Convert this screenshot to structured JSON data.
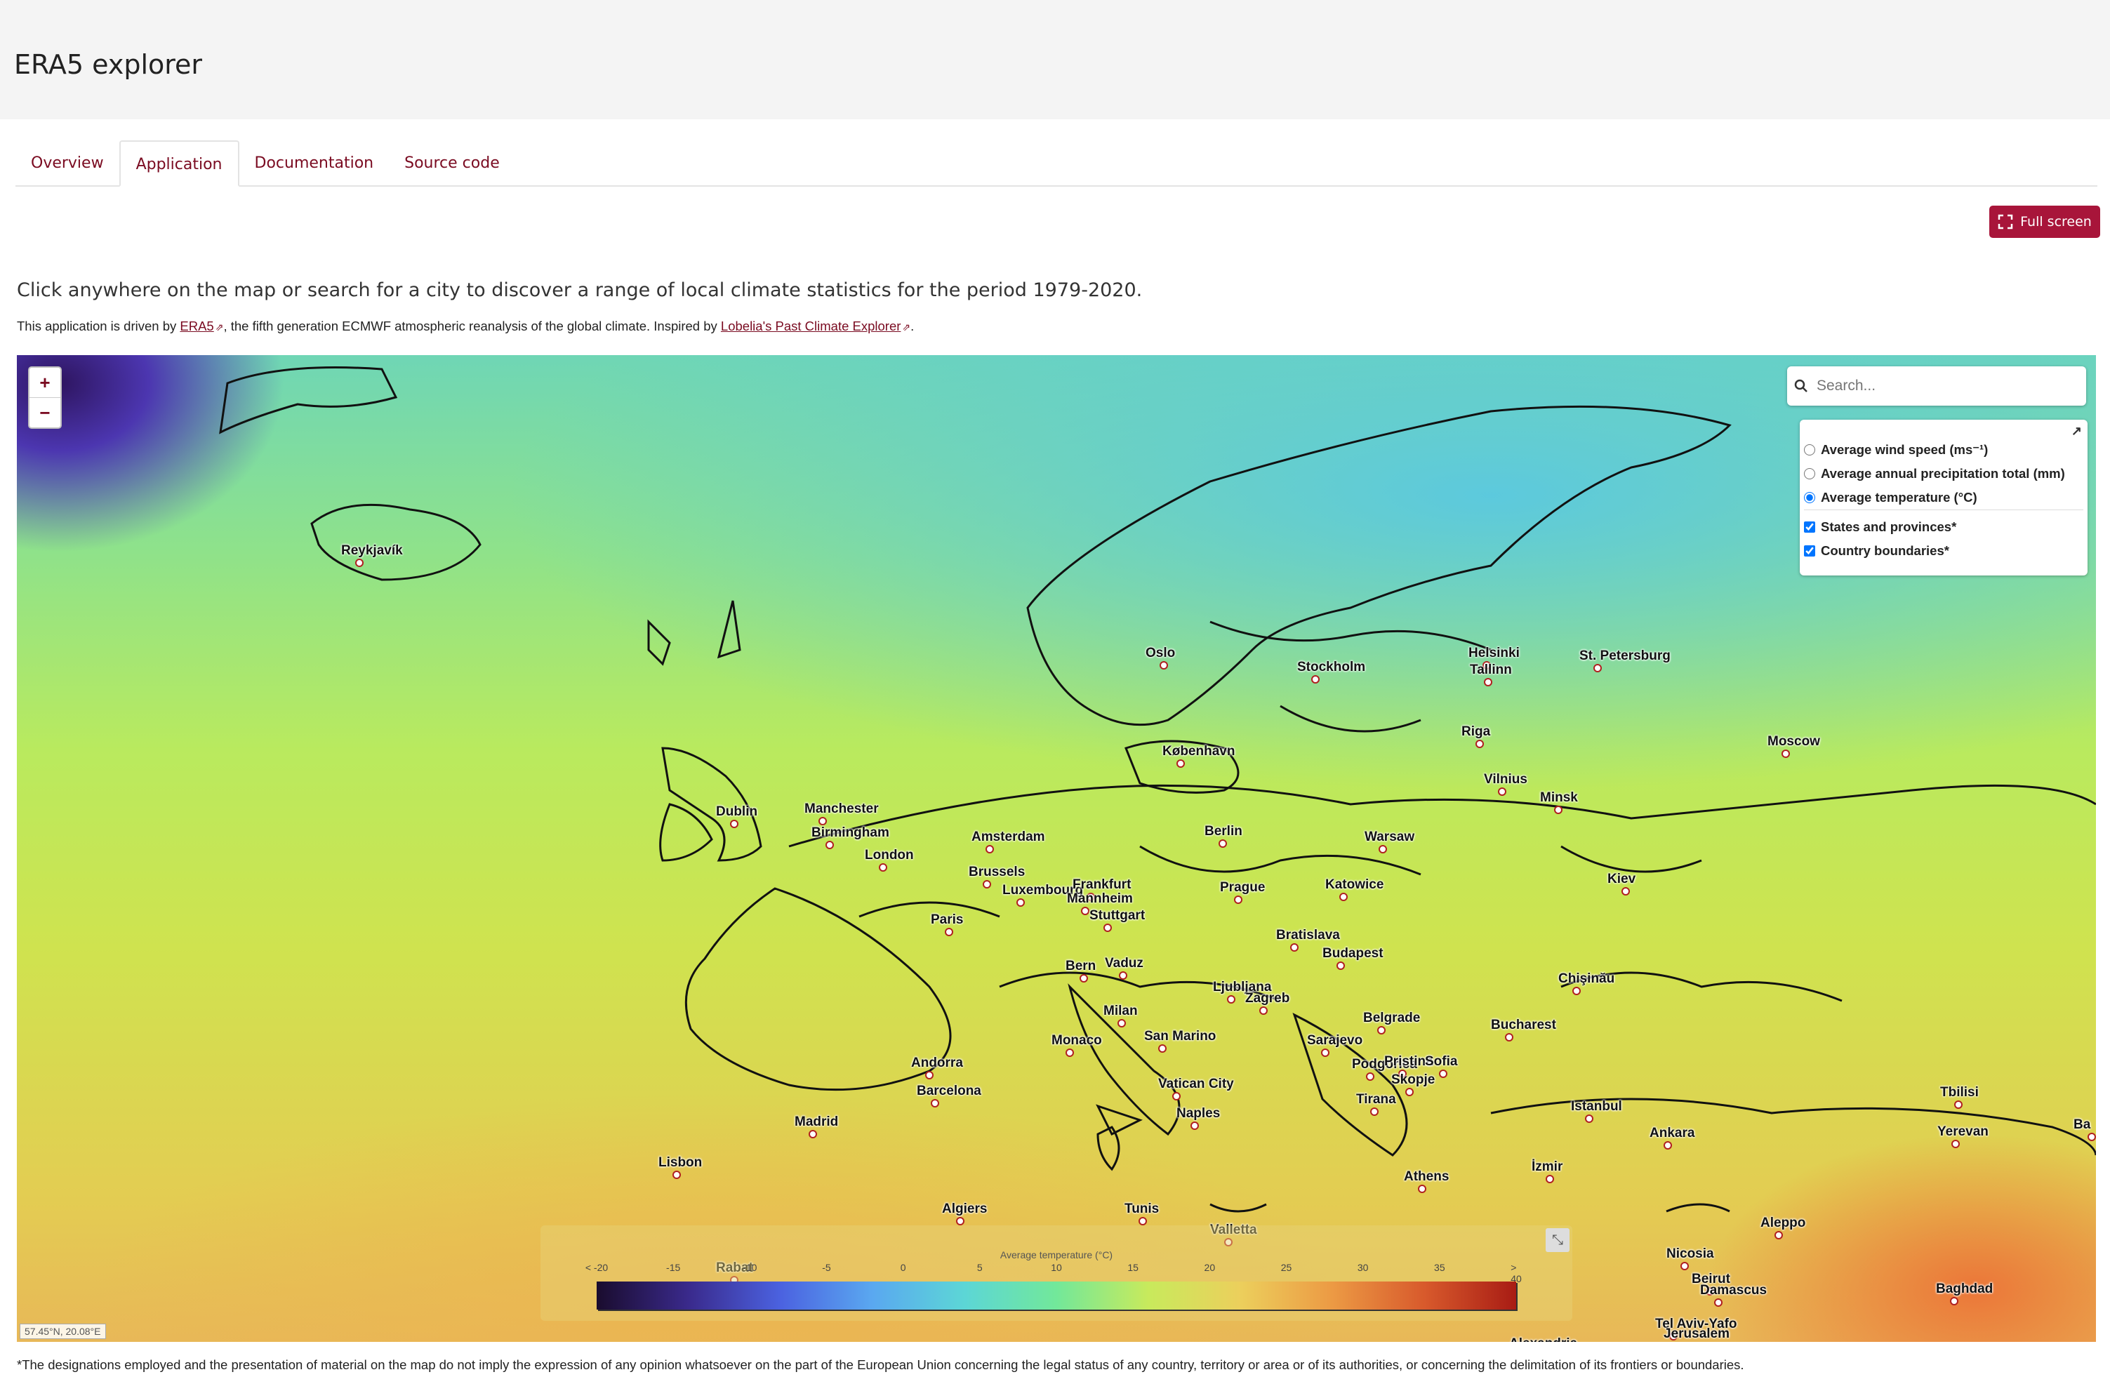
{
  "app_title": "ERA5 explorer",
  "tabs": [
    {
      "label": "Overview",
      "active": false
    },
    {
      "label": "Application",
      "active": true
    },
    {
      "label": "Documentation",
      "active": false
    },
    {
      "label": "Source code",
      "active": false
    }
  ],
  "fullscreen_label": "Full screen",
  "intro": "Click anywhere on the map or search for a city to discover a range of local climate statistics for the period 1979-2020.",
  "credit": {
    "prefix": "This application is driven by ",
    "link1": "ERA5",
    "middle": ", the fifth generation ECMWF atmospheric reanalysis of the global climate. Inspired by ",
    "link2": "Lobelia's Past Climate Explorer",
    "suffix": "."
  },
  "map": {
    "zoom_in": "+",
    "zoom_out": "−",
    "search_placeholder": "Search...",
    "layers": {
      "collapse_icon": "↗",
      "base": [
        {
          "label": "Average wind speed (ms⁻¹)",
          "selected": false
        },
        {
          "label": "Average annual precipitation total (mm)",
          "selected": false
        },
        {
          "label": "Average temperature (°C)",
          "selected": true
        }
      ],
      "overlays": [
        {
          "label": "States and provinces*",
          "checked": true
        },
        {
          "label": "Country boundaries*",
          "checked": true
        }
      ]
    },
    "cities": [
      "Reykjavík",
      "Oslo",
      "Stockholm",
      "Helsinki",
      "Tallinn",
      "St. Petersburg",
      "Riga",
      "Moscow",
      "København",
      "Vilnius",
      "Minsk",
      "Dublin",
      "Manchester",
      "Birmingham",
      "London",
      "Amsterdam",
      "Berlin",
      "Warsaw",
      "Brussels",
      "Luxembourg",
      "Frankfurt",
      "Mannheim",
      "Stuttgart",
      "Prague",
      "Katowice",
      "Kiev",
      "Paris",
      "Bratislava",
      "Budapest",
      "Vaduz",
      "Bern",
      "Ljubljana",
      "Zagreb",
      "Chişinău",
      "Milan",
      "Belgrade",
      "Bucharest",
      "Monaco",
      "San Marino",
      "Sarajevo",
      "Andorra",
      "Podgorica",
      "Pristina",
      "Sofia",
      "Skopje",
      "Barcelona",
      "Vatican City",
      "Tirana",
      "Naples",
      "Istanbul",
      "Tbilisi",
      "Madrid",
      "Ankara",
      "Yerevan",
      "Lisbon",
      "Athens",
      "İzmir",
      "Algiers",
      "Tunis",
      "Valletta",
      "Aleppo",
      "Rabat",
      "Nicosia",
      "Beirut",
      "Damascus",
      "Baghdad",
      "Tel Aviv-Yafo",
      "Jerusalem",
      "Alexandria",
      "Ba"
    ],
    "legend": {
      "title": "Average temperature (°C)",
      "ticks": [
        "< -20",
        "-15",
        "-10",
        "-5",
        "0",
        "5",
        "10",
        "15",
        "20",
        "25",
        "30",
        "35",
        "> 40"
      ]
    },
    "coords": "57.45°N, 20.08°E"
  },
  "disclaimer": "*The designations employed and the presentation of material on the map do not imply the expression of any opinion whatsoever on the part of the European Union concerning the legal status of any country, territory or area or of its authorities, or concerning the delimitation of its frontiers or boundaries.",
  "colors": {
    "accent": "#a8153a",
    "link": "#7a0b21"
  }
}
